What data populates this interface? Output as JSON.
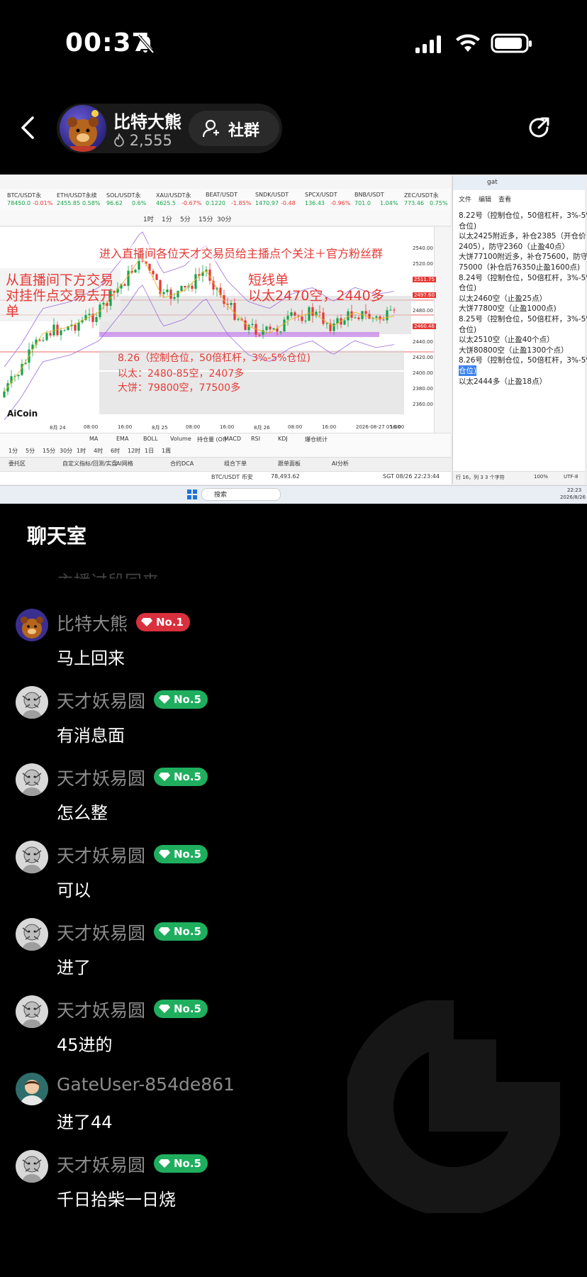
{
  "status_bar": {
    "time": "00:37"
  },
  "header": {
    "host_name": "比特大熊",
    "fans_count": "2,555",
    "community_label": "社群"
  },
  "video": {
    "overlay_top": "进入直播间各位天才交易员给主播点个关注＋官方粉丝群",
    "overlay_left_1": "从直播间下方交易",
    "overlay_left_2": "对挂件点交易去开",
    "overlay_left_3": "单",
    "overlay_short_1": "短线单",
    "overlay_short_2": "以太2470空，2440多",
    "overlay_826": "8.26（控制仓位，50倍杠杆，3%-5%仓位)",
    "overlay_eth": "以太：2480-85空，2407多",
    "overlay_btc": "大饼：79800空，77500多",
    "tickers": [
      {
        "name": "BTC/USDT永",
        "price": "78450.0",
        "change": "-0.01%"
      },
      {
        "name": "ETH/USDT永续",
        "price": "2455.85",
        "change": "0.58%"
      },
      {
        "name": "SOL/USDT永",
        "price": "96.62",
        "change": "0.6%"
      },
      {
        "name": "XAU/USDT永",
        "price": "4625.5",
        "change": "-0.67%"
      },
      {
        "name": "BEAT/USDT",
        "price": "0.1220",
        "change": "-1.85%"
      },
      {
        "name": "SNDK/USDT",
        "price": "1470.97",
        "change": "-0.48"
      },
      {
        "name": "SPCX/USDT",
        "price": "136.43",
        "change": "-0.96%"
      },
      {
        "name": "BNB/USDT",
        "price": "701.0",
        "change": "1.04%"
      },
      {
        "name": "ZEC/USDT永",
        "price": "773.46",
        "change": "0.75%"
      }
    ],
    "timeframes": [
      "1时",
      "1分",
      "5分",
      "15分",
      "30分"
    ],
    "price_labels": [
      "2540.00",
      "2520.00",
      "2511.75",
      "2497.60",
      "2480.00",
      "2460.46",
      "2440.00",
      "2420.00",
      "2400.00",
      "2380.00",
      "2360.00"
    ],
    "date_labels": [
      "8月 24",
      "08:00",
      "16:00",
      "8月 25",
      "08:00",
      "16:00",
      "8月 26",
      "08:00",
      "16:00",
      "2026-08-27 05:00",
      "16:00"
    ],
    "bottom_tabs": [
      "1分",
      "5分",
      "15分",
      "30分",
      "1时",
      "4时",
      "6时",
      "12时",
      "1日",
      "1周"
    ],
    "indicator_tabs": [
      "MA",
      "EMA",
      "BOLL",
      "Volume",
      "持仓量 (OI)",
      "MACD",
      "RSI",
      "KDJ",
      "爆仓统计"
    ],
    "panel_tabs": [
      "委托区",
      "自定义指标/回测/实盘",
      "AI网格",
      "合约DCA",
      "组合下单",
      "跟单面板",
      "AI分析"
    ],
    "footer_pair": "BTC/USDT 币安",
    "footer_price": "78,493.62",
    "footer_time": "SGT 08/26 22:23:44",
    "logo": "AiCoin",
    "taskbar_search": "搜索",
    "taskbar_clock": "22:23",
    "taskbar_date": "2026/8/26"
  },
  "notepad": {
    "tab": "gat",
    "menu": [
      "文件",
      "编辑",
      "查看"
    ],
    "lines": [
      "8.22号（控制仓位，50倍杠杆，3%-5%",
      "仓位)",
      "以太2425附近多，补仓2385（开仓价",
      "2405），防守2360（止盈40点）",
      "大饼77100附近多，补仓75600，防守",
      "75000（补仓后76350止盈1600点)",
      "8.24号（控制仓位，50倍杠杆，3%-5%",
      "仓位)",
      "以太2460空（止盈25点）",
      "大饼77800空（止盈1000点)",
      "8.25号（控制仓位，50倍杠杆，3%-5%",
      "仓位)",
      "以太2510空（止盈40个点）",
      "大饼80800空（止盈1300个点）",
      "8.26号（控制仓位，50倍杠杆，3%-5%",
      "仓位)",
      "以太2444多（止盈18点）"
    ],
    "status": "行 16，列 3  3 个字符",
    "zoom": "100%",
    "encoding": "UTF-8"
  },
  "chat": {
    "title": "聊天室",
    "faded_line": "主播过段回来",
    "messages": [
      {
        "name": "比特大熊",
        "badge": "No.1",
        "text": "马上回来",
        "avatar": "bear"
      },
      {
        "name": "天才妖易圆",
        "badge": "No.5",
        "text": "有消息面",
        "avatar": "sketch"
      },
      {
        "name": "天才妖易圆",
        "badge": "No.5",
        "text": "怎么整",
        "avatar": "sketch"
      },
      {
        "name": "天才妖易圆",
        "badge": "No.5",
        "text": "可以",
        "avatar": "sketch"
      },
      {
        "name": "天才妖易圆",
        "badge": "No.5",
        "text": "进了",
        "avatar": "sketch"
      },
      {
        "name": "天才妖易圆",
        "badge": "No.5",
        "text": "45进的",
        "avatar": "sketch"
      },
      {
        "name": "GateUser-854de861",
        "badge": "",
        "text": "进了44",
        "avatar": "person"
      },
      {
        "name": "天才妖易圆",
        "badge": "No.5",
        "text": "千日拾柴一日烧",
        "avatar": "sketch"
      }
    ]
  },
  "colors": {
    "badge_red": "#d9303e",
    "badge_green": "#1fae5e",
    "overlay_red": "#e53935"
  }
}
